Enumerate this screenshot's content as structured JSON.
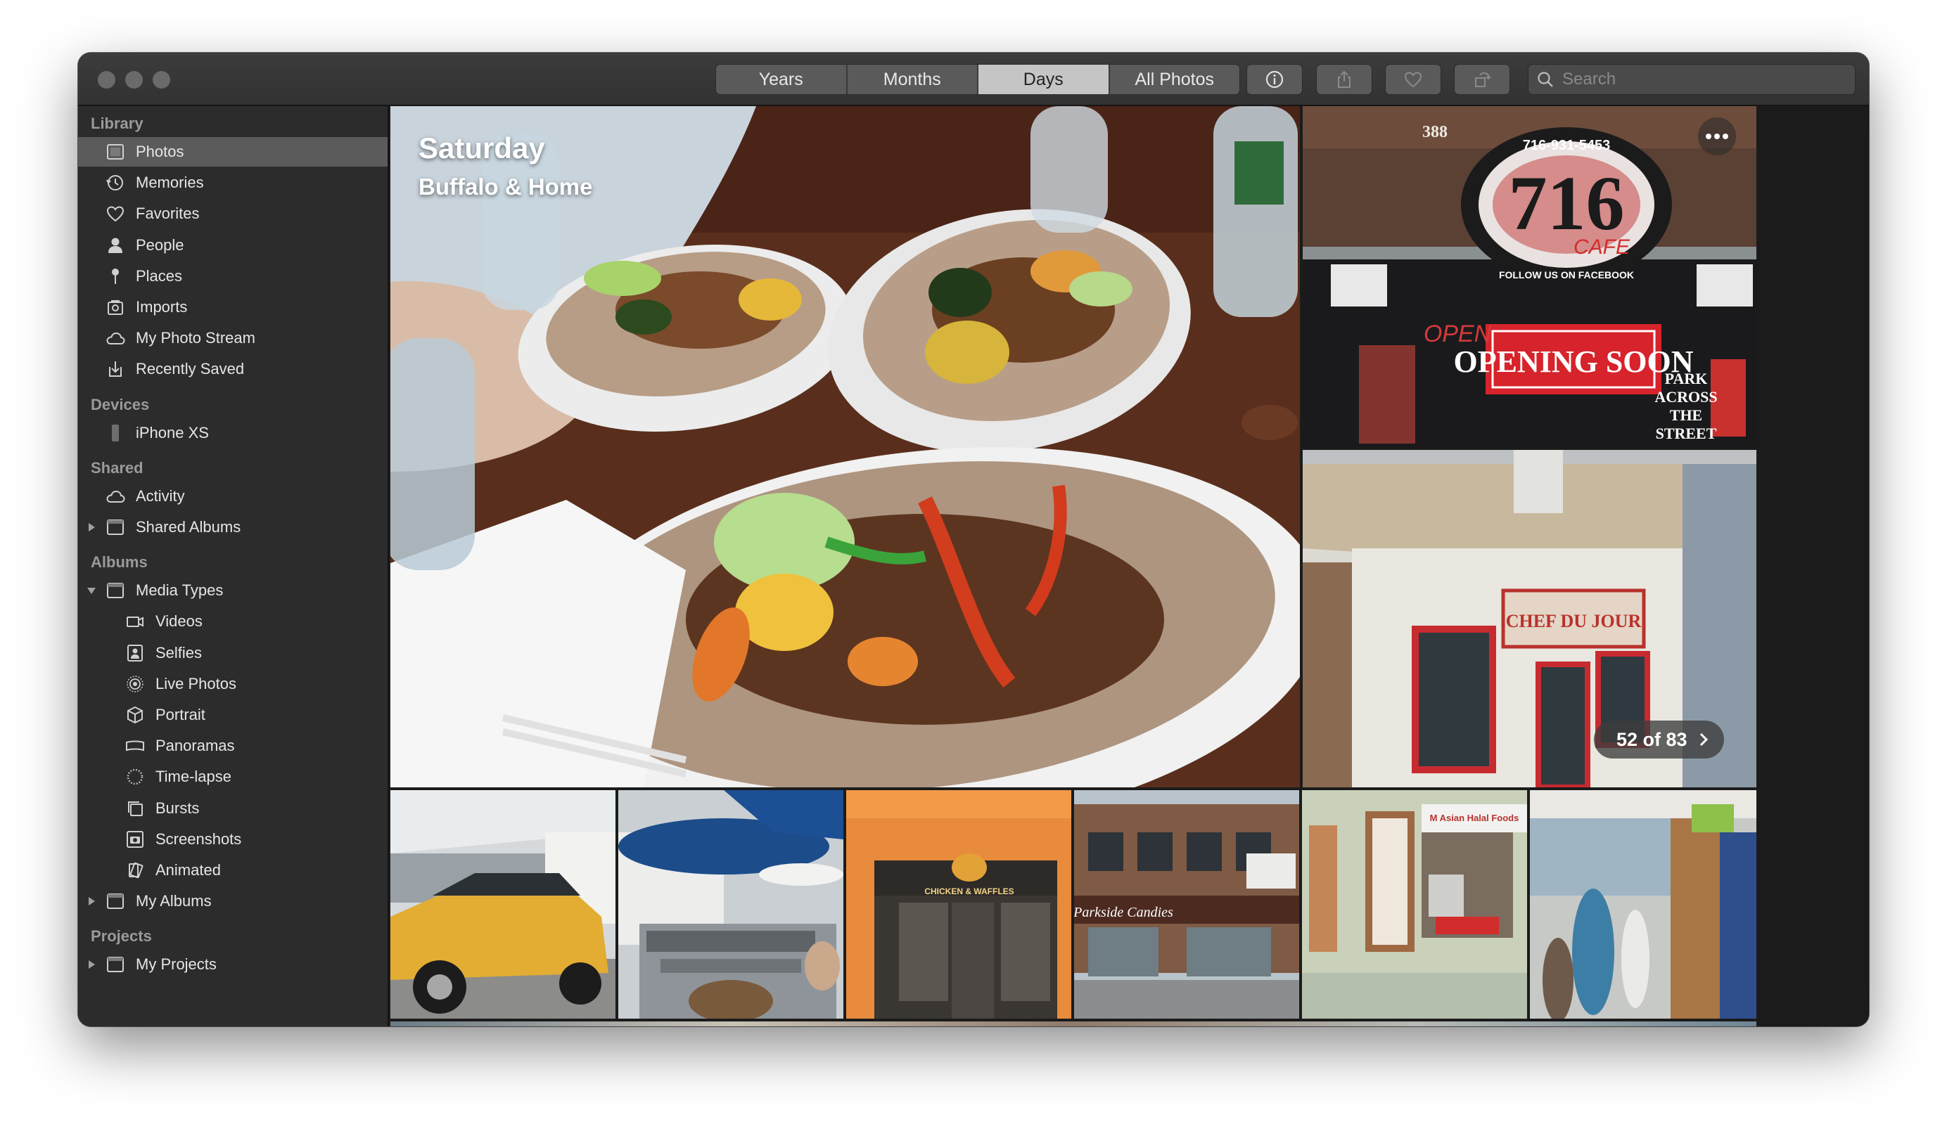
{
  "toolbar": {
    "view_tabs": [
      "Years",
      "Months",
      "Days",
      "All Photos"
    ],
    "active_tab": "Days",
    "search_placeholder": "Search"
  },
  "sidebar": {
    "sections": [
      {
        "title": "Library",
        "items": [
          {
            "label": "Photos",
            "icon": "photos-icon",
            "selected": true
          },
          {
            "label": "Memories",
            "icon": "memories-icon"
          },
          {
            "label": "Favorites",
            "icon": "heart-icon"
          },
          {
            "label": "People",
            "icon": "person-icon"
          },
          {
            "label": "Places",
            "icon": "pin-icon"
          },
          {
            "label": "Imports",
            "icon": "imports-icon"
          },
          {
            "label": "My Photo Stream",
            "icon": "cloud-icon"
          },
          {
            "label": "Recently Saved",
            "icon": "saved-icon"
          }
        ]
      },
      {
        "title": "Devices",
        "items": [
          {
            "label": "iPhone XS",
            "icon": "phone-icon"
          }
        ]
      },
      {
        "title": "Shared",
        "items": [
          {
            "label": "Activity",
            "icon": "cloud-icon"
          },
          {
            "label": "Shared Albums",
            "icon": "folder-icon",
            "disclosure": "collapsed"
          }
        ]
      },
      {
        "title": "Albums",
        "items": [
          {
            "label": "Media Types",
            "icon": "folder-icon",
            "disclosure": "expanded"
          },
          {
            "label": "Videos",
            "icon": "video-icon",
            "indent": true
          },
          {
            "label": "Selfies",
            "icon": "selfie-icon",
            "indent": true
          },
          {
            "label": "Live Photos",
            "icon": "live-icon",
            "indent": true
          },
          {
            "label": "Portrait",
            "icon": "cube-icon",
            "indent": true
          },
          {
            "label": "Panoramas",
            "icon": "panorama-icon",
            "indent": true
          },
          {
            "label": "Time-lapse",
            "icon": "timelapse-icon",
            "indent": true
          },
          {
            "label": "Bursts",
            "icon": "bursts-icon",
            "indent": true
          },
          {
            "label": "Screenshots",
            "icon": "camera-icon",
            "indent": true
          },
          {
            "label": "Animated",
            "icon": "animated-icon",
            "indent": true
          },
          {
            "label": "My Albums",
            "icon": "folder-icon",
            "disclosure": "collapsed"
          }
        ]
      },
      {
        "title": "Projects",
        "items": [
          {
            "label": "My Projects",
            "icon": "folder-icon",
            "disclosure": "collapsed"
          }
        ]
      }
    ]
  },
  "day_view": {
    "title": "Saturday",
    "subtitle": "Buffalo & Home",
    "count_label": "52 of 83",
    "sign_716_phone": "716-931-5453",
    "sign_716_number": "716",
    "sign_716_cafe": "CAFE",
    "sign_716_facebook": "FOLLOW US ON FACEBOOK",
    "building_number": "388",
    "sign_opening_soon": "OPENING SOON",
    "sign_open": "OPEN",
    "sign_park": [
      "PARK",
      "ACROSS",
      "THE",
      "STREET"
    ],
    "sign_chef": "CHEF DU JOUR",
    "sign_waffles": "CHICKEN & WAFFLES",
    "sign_parkside": "Parkside Candies",
    "sign_halal": "M Asian Halal Foods"
  },
  "colors": {
    "accent_red": "#d8242c",
    "selection": "#5b5b5b"
  }
}
